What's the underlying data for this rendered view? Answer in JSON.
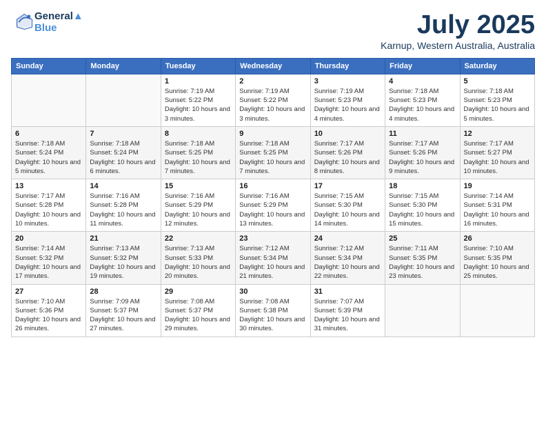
{
  "header": {
    "logo_line1": "General",
    "logo_line2": "Blue",
    "month": "July 2025",
    "location": "Karnup, Western Australia, Australia"
  },
  "weekdays": [
    "Sunday",
    "Monday",
    "Tuesday",
    "Wednesday",
    "Thursday",
    "Friday",
    "Saturday"
  ],
  "weeks": [
    [
      {
        "day": "",
        "info": ""
      },
      {
        "day": "",
        "info": ""
      },
      {
        "day": "1",
        "info": "Sunrise: 7:19 AM\nSunset: 5:22 PM\nDaylight: 10 hours and 3 minutes."
      },
      {
        "day": "2",
        "info": "Sunrise: 7:19 AM\nSunset: 5:22 PM\nDaylight: 10 hours and 3 minutes."
      },
      {
        "day": "3",
        "info": "Sunrise: 7:19 AM\nSunset: 5:23 PM\nDaylight: 10 hours and 4 minutes."
      },
      {
        "day": "4",
        "info": "Sunrise: 7:18 AM\nSunset: 5:23 PM\nDaylight: 10 hours and 4 minutes."
      },
      {
        "day": "5",
        "info": "Sunrise: 7:18 AM\nSunset: 5:23 PM\nDaylight: 10 hours and 5 minutes."
      }
    ],
    [
      {
        "day": "6",
        "info": "Sunrise: 7:18 AM\nSunset: 5:24 PM\nDaylight: 10 hours and 5 minutes."
      },
      {
        "day": "7",
        "info": "Sunrise: 7:18 AM\nSunset: 5:24 PM\nDaylight: 10 hours and 6 minutes."
      },
      {
        "day": "8",
        "info": "Sunrise: 7:18 AM\nSunset: 5:25 PM\nDaylight: 10 hours and 7 minutes."
      },
      {
        "day": "9",
        "info": "Sunrise: 7:18 AM\nSunset: 5:25 PM\nDaylight: 10 hours and 7 minutes."
      },
      {
        "day": "10",
        "info": "Sunrise: 7:17 AM\nSunset: 5:26 PM\nDaylight: 10 hours and 8 minutes."
      },
      {
        "day": "11",
        "info": "Sunrise: 7:17 AM\nSunset: 5:26 PM\nDaylight: 10 hours and 9 minutes."
      },
      {
        "day": "12",
        "info": "Sunrise: 7:17 AM\nSunset: 5:27 PM\nDaylight: 10 hours and 10 minutes."
      }
    ],
    [
      {
        "day": "13",
        "info": "Sunrise: 7:17 AM\nSunset: 5:28 PM\nDaylight: 10 hours and 10 minutes."
      },
      {
        "day": "14",
        "info": "Sunrise: 7:16 AM\nSunset: 5:28 PM\nDaylight: 10 hours and 11 minutes."
      },
      {
        "day": "15",
        "info": "Sunrise: 7:16 AM\nSunset: 5:29 PM\nDaylight: 10 hours and 12 minutes."
      },
      {
        "day": "16",
        "info": "Sunrise: 7:16 AM\nSunset: 5:29 PM\nDaylight: 10 hours and 13 minutes."
      },
      {
        "day": "17",
        "info": "Sunrise: 7:15 AM\nSunset: 5:30 PM\nDaylight: 10 hours and 14 minutes."
      },
      {
        "day": "18",
        "info": "Sunrise: 7:15 AM\nSunset: 5:30 PM\nDaylight: 10 hours and 15 minutes."
      },
      {
        "day": "19",
        "info": "Sunrise: 7:14 AM\nSunset: 5:31 PM\nDaylight: 10 hours and 16 minutes."
      }
    ],
    [
      {
        "day": "20",
        "info": "Sunrise: 7:14 AM\nSunset: 5:32 PM\nDaylight: 10 hours and 17 minutes."
      },
      {
        "day": "21",
        "info": "Sunrise: 7:13 AM\nSunset: 5:32 PM\nDaylight: 10 hours and 19 minutes."
      },
      {
        "day": "22",
        "info": "Sunrise: 7:13 AM\nSunset: 5:33 PM\nDaylight: 10 hours and 20 minutes."
      },
      {
        "day": "23",
        "info": "Sunrise: 7:12 AM\nSunset: 5:34 PM\nDaylight: 10 hours and 21 minutes."
      },
      {
        "day": "24",
        "info": "Sunrise: 7:12 AM\nSunset: 5:34 PM\nDaylight: 10 hours and 22 minutes."
      },
      {
        "day": "25",
        "info": "Sunrise: 7:11 AM\nSunset: 5:35 PM\nDaylight: 10 hours and 23 minutes."
      },
      {
        "day": "26",
        "info": "Sunrise: 7:10 AM\nSunset: 5:35 PM\nDaylight: 10 hours and 25 minutes."
      }
    ],
    [
      {
        "day": "27",
        "info": "Sunrise: 7:10 AM\nSunset: 5:36 PM\nDaylight: 10 hours and 26 minutes."
      },
      {
        "day": "28",
        "info": "Sunrise: 7:09 AM\nSunset: 5:37 PM\nDaylight: 10 hours and 27 minutes."
      },
      {
        "day": "29",
        "info": "Sunrise: 7:08 AM\nSunset: 5:37 PM\nDaylight: 10 hours and 29 minutes."
      },
      {
        "day": "30",
        "info": "Sunrise: 7:08 AM\nSunset: 5:38 PM\nDaylight: 10 hours and 30 minutes."
      },
      {
        "day": "31",
        "info": "Sunrise: 7:07 AM\nSunset: 5:39 PM\nDaylight: 10 hours and 31 minutes."
      },
      {
        "day": "",
        "info": ""
      },
      {
        "day": "",
        "info": ""
      }
    ]
  ]
}
